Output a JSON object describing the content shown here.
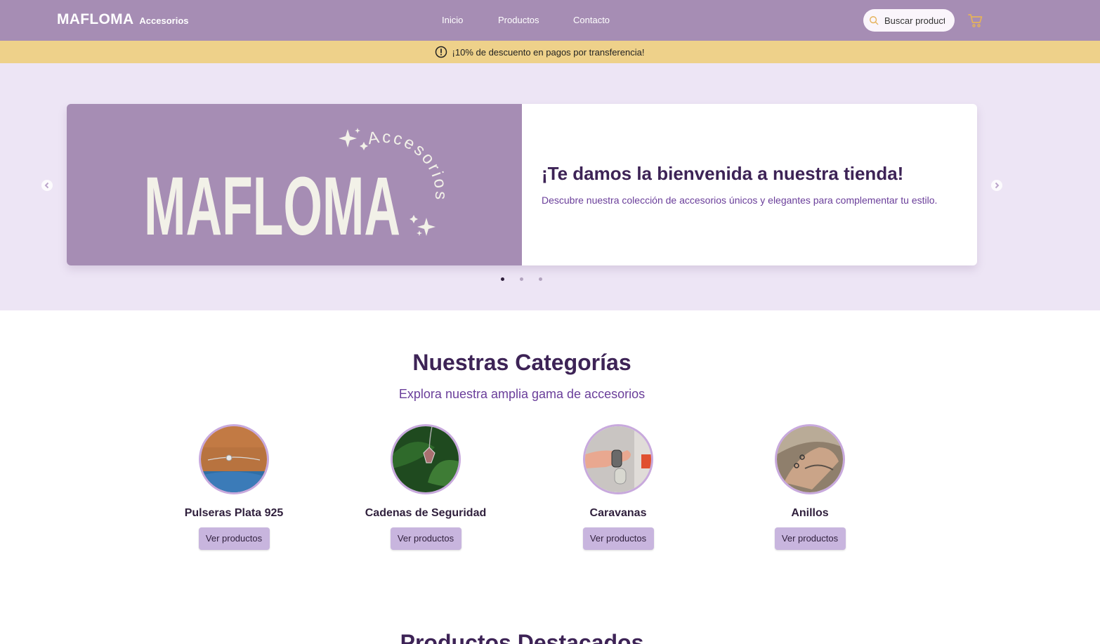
{
  "header": {
    "brand_name": "MAFLOMA",
    "brand_sub": "Accesorios",
    "nav": [
      "Inicio",
      "Productos",
      "Contacto"
    ],
    "search_placeholder": "Buscar productos",
    "cart_icon": "cart-icon",
    "search_icon": "search-icon"
  },
  "promo": {
    "icon": "alert-circle-icon",
    "text": "¡10% de descuento en pagos por transferencia!"
  },
  "hero": {
    "logo_text": "MAFLOMA",
    "logo_sub": "Accesorios",
    "title": "¡Te damos la bienvenida a nuestra tienda!",
    "description": "Descubre nuestra colección de accesorios únicos y elegantes para complementar tu estilo.",
    "active_slide": 1,
    "slide_count": 3
  },
  "categories": {
    "title": "Nuestras Categorías",
    "subtitle": "Explora nuestra amplia gama de accesorios",
    "items": [
      {
        "name": "Pulseras Plata 925",
        "button": "Ver productos"
      },
      {
        "name": "Cadenas de Seguridad",
        "button": "Ver productos"
      },
      {
        "name": "Caravanas",
        "button": "Ver productos"
      },
      {
        "name": "Anillos",
        "button": "Ver productos"
      }
    ]
  },
  "featured": {
    "title": "Productos Destacados"
  },
  "colors": {
    "header": "#a68db4",
    "promo": "#eed18a",
    "hero_bg": "#ede5f5",
    "title": "#3d2356",
    "accent": "#6a3e9a",
    "button": "#c8b5de",
    "cart_icon": "#e5b25a"
  }
}
